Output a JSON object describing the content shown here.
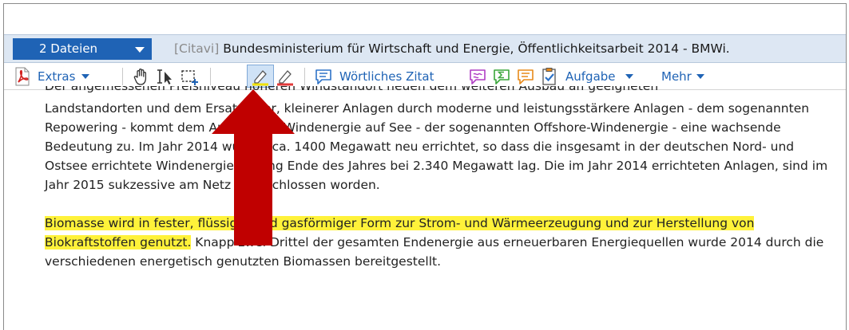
{
  "header": {
    "files_label": "2 Dateien",
    "title_prefix": "[Citavi]",
    "title": "Bundesministerium für Wirtschaft und Energie, Öffentlichkeitsarbeit 2014 - BMWi."
  },
  "toolbar": {
    "extras_label": "Extras",
    "quote_label": "Wörtliches Zitat",
    "task_label": "Aufgabe",
    "more_label": "Mehr"
  },
  "document": {
    "cut_line": "Der angemessenen Preisniveau höheren Windstandort neuen dem weiteren Ausbau an geeigneten",
    "paragraph1": "Landstandorten und dem Ersatz alter, kleinerer Anlagen durch moderne und leistungsstärkere Anlagen - dem sogenannten Repowering - kommt dem Ausbau der Windenergie auf See - der sogenannten Offshore-Windenergie - eine wachsende Bedeutung zu. Im Jahr 2014 wurden ca. 1400 Megawatt  neu errichtet, so dass die insgesamt in der deutschen Nord- und Ostsee errichtete Windenergieleistung Ende des Jahres bei 2.340 Megawatt lag. Die im Jahr 2014 errichteten Anlagen, sind im Jahr 2015 sukzessive am Netz angeschlossen worden.",
    "paragraph2_highlighted": "Biomasse wird in fester, flüssiger und gasförmiger Form zur Strom- und Wärmeerzeugung und zur Herstellung von Biokraftstoffen genutzt.",
    "paragraph2_rest": " Knapp zwei Drittel der gesamten Endenergie aus erneuerbaren Energiequellen wurde 2014 durch die verschiedenen energetisch genutzten Biomassen bereitgestellt."
  },
  "colors": {
    "accent": "#1f63b5",
    "highlight": "#fff23a",
    "arrow": "#c00000"
  }
}
